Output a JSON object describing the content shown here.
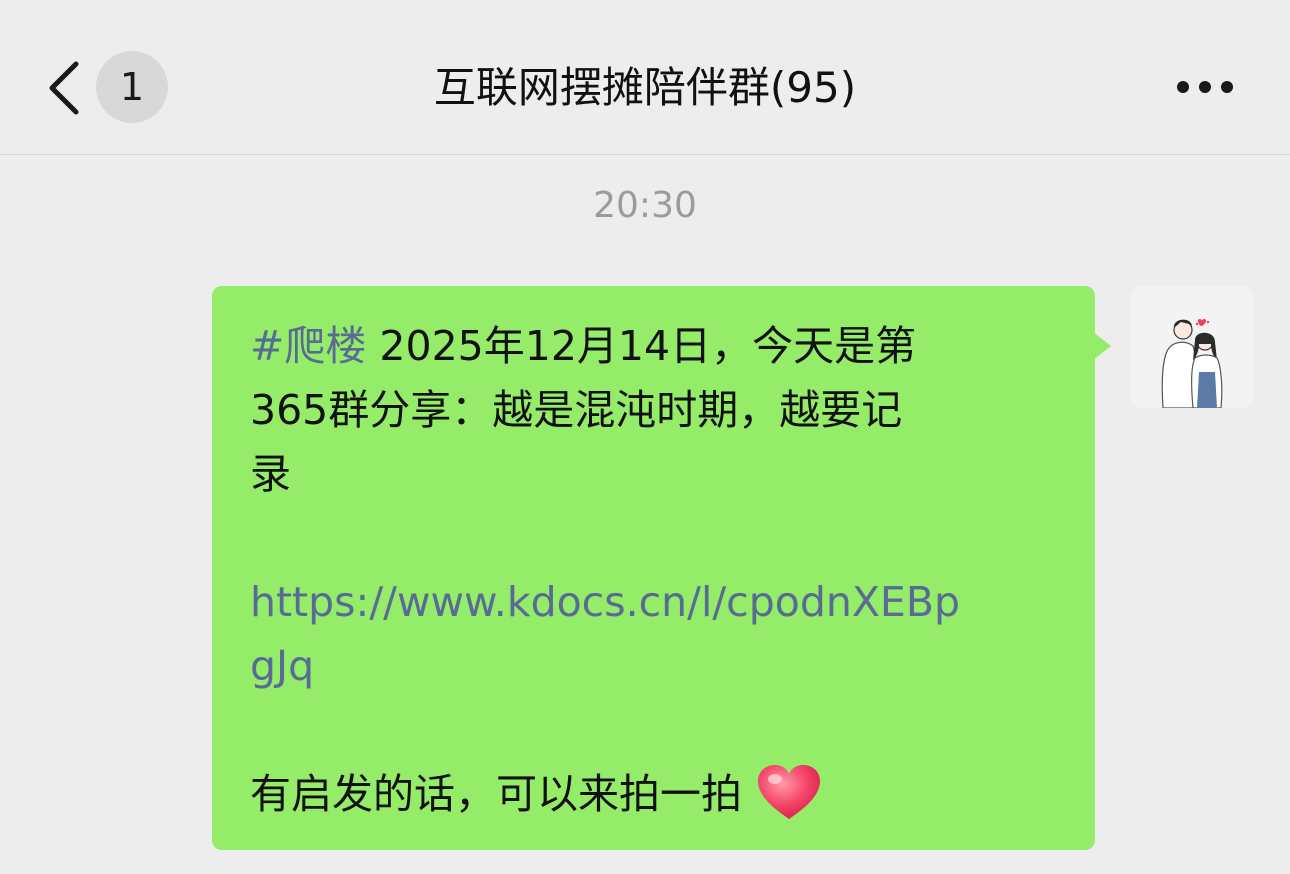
{
  "header": {
    "back_icon": "chevron-left-icon",
    "unread_count": "1",
    "title": "互联网摆摊陪伴群(95)",
    "more_icon": "more-horizontal-icon"
  },
  "chat": {
    "timestamp": "20:30",
    "message": {
      "hashtag": "#爬楼",
      "line1_rest": " 2025年12月14日，今天是第",
      "line2": "365群分享：越是混沌时期，越要记",
      "line3": "录",
      "link_line1": "https://www.kdocs.cn/l/cpodnXEBp",
      "link_line2": "gJq",
      "closing": "有启发的话，可以来拍一拍",
      "emoji": "heart-emoji"
    },
    "bubble_color": "#95ec69",
    "link_color": "#576b95",
    "avatar": "couple-illustration-avatar"
  },
  "colors": {
    "background": "#ededed",
    "timestamp": "#9b9b9b",
    "badge": "#d8d8d8"
  }
}
